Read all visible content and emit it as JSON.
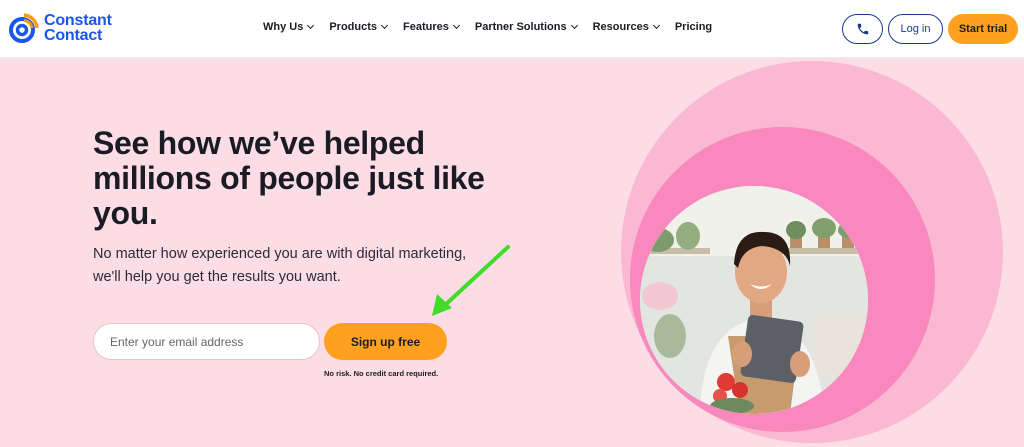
{
  "brand": {
    "name_line1": "Constant",
    "name_line2": "Contact",
    "logo_colors": {
      "blue": "#1856ed",
      "orange": "#ff9b0f"
    }
  },
  "nav": {
    "items": [
      {
        "label": "Why Us",
        "has_dropdown": true
      },
      {
        "label": "Products",
        "has_dropdown": true
      },
      {
        "label": "Features",
        "has_dropdown": true
      },
      {
        "label": "Partner Solutions",
        "has_dropdown": true
      },
      {
        "label": "Resources",
        "has_dropdown": true
      },
      {
        "label": "Pricing",
        "has_dropdown": false
      }
    ],
    "phone_icon": "phone-icon",
    "login_label": "Log in",
    "trial_label": "Start trial"
  },
  "hero": {
    "headline": "See how we’ve helped millions of people just like you.",
    "subhead": "No matter how experienced you are with digital marketing, we'll help you get the results you want.",
    "email_placeholder": "Enter your email address",
    "email_value": "",
    "signup_label": "Sign up free",
    "fineprint": "No risk. No credit card required."
  },
  "colors": {
    "background": "#fcdde6",
    "accent_orange": "#ffa11e",
    "outline_blue": "#1b3a8f",
    "circle_light": "#fbb8d2",
    "circle_mid": "#f888bd",
    "arrow_green": "#3fdc2a"
  }
}
